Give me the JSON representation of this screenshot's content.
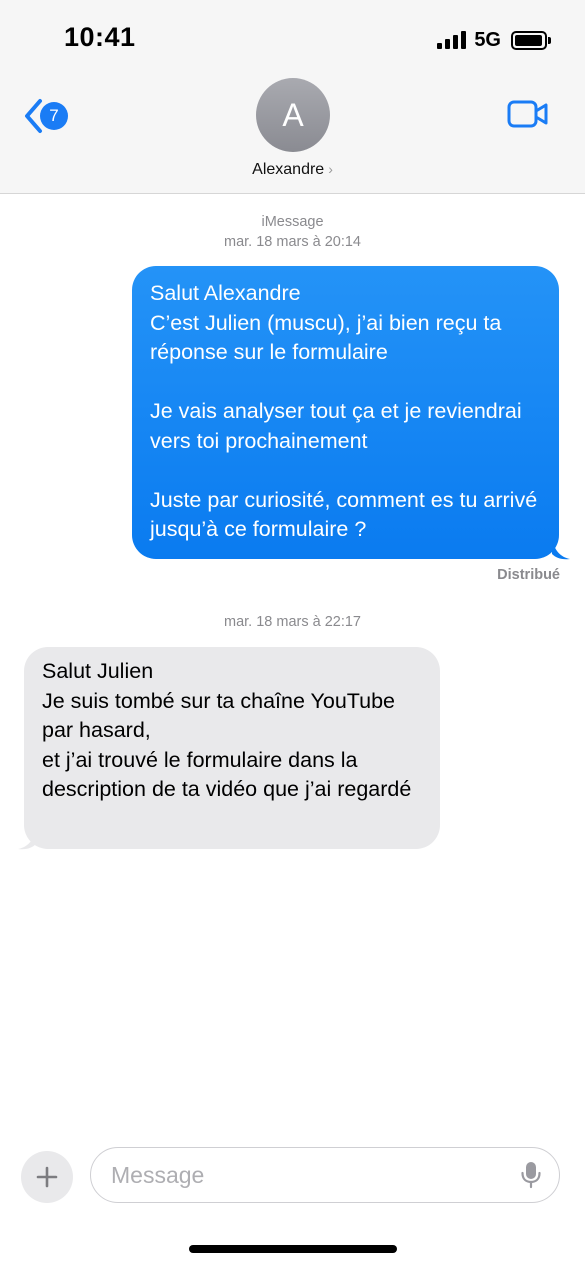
{
  "status_bar": {
    "time": "10:41",
    "network": "5G",
    "icons": [
      "cellular-signal-icon",
      "battery-icon"
    ]
  },
  "header": {
    "back_badge": "7",
    "avatar_initial": "A",
    "contact_name": "Alexandre",
    "contact_chevron": "›",
    "icons": [
      "back-chevron-icon",
      "video-camera-icon"
    ]
  },
  "conversation": {
    "service_label": "iMessage",
    "first_timestamp": "mar. 18 mars à 20:14",
    "sent_message": "Salut Alexandre\nC’est Julien (muscu), j’ai bien reçu ta réponse sur le formulaire\n\nJe vais analyser tout ça et je reviendrai vers toi prochainement\n\nJuste par curiosité, comment es tu arrivé jusqu’à ce formulaire ?",
    "delivery_status": "Distribué",
    "second_timestamp": "mar. 18 mars à 22:17",
    "received_message": "Salut Julien\nJe suis tombé sur ta chaîne YouTube par hasard,\net j’ai trouvé le formulaire dans la description de ta vidéo que j’ai regardé"
  },
  "composer": {
    "placeholder": "Message",
    "value": "",
    "icons": [
      "plus-icon",
      "microphone-icon"
    ]
  },
  "colors": {
    "accent": "#1a7cf5",
    "sent_bubble": "#0a7bf0",
    "received_bubble": "#e9e9eb",
    "secondary_text": "#8a8a8e"
  }
}
